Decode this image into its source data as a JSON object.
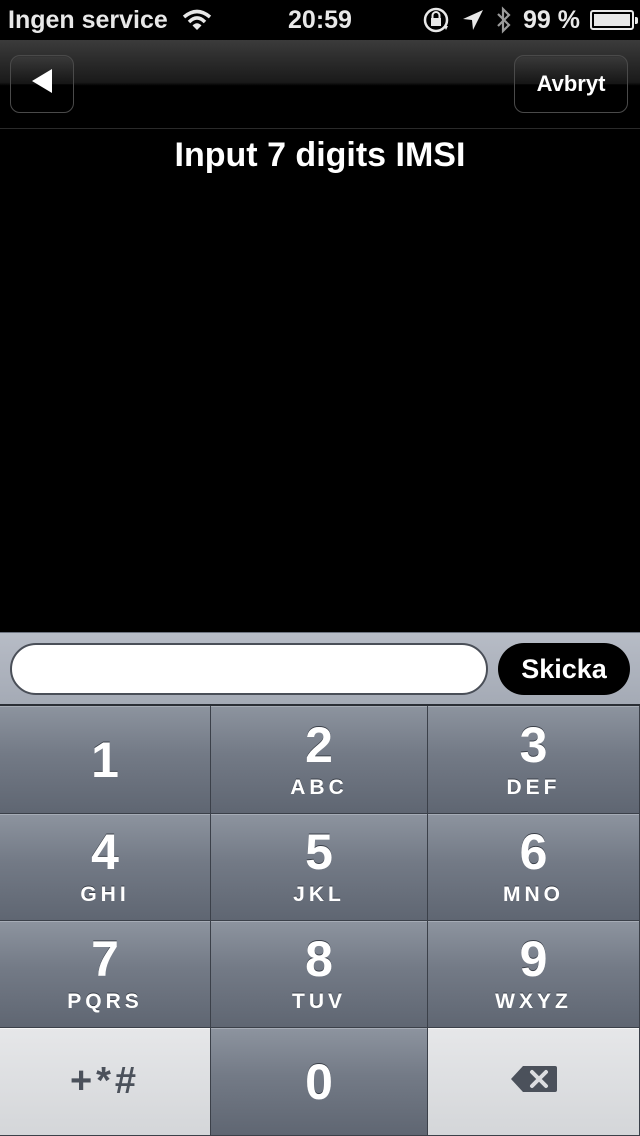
{
  "status_bar": {
    "carrier": "Ingen service",
    "time": "20:59",
    "battery": "99 %",
    "battery_level": 0.99,
    "icons": [
      "wifi-icon",
      "rotation-lock-icon",
      "location-arrow-icon",
      "bluetooth-icon",
      "battery-icon"
    ]
  },
  "navbar": {
    "back_icon": "back-arrow-icon",
    "cancel_label": "Avbryt"
  },
  "prompt": {
    "title": "Input 7 digits IMSI"
  },
  "input_bar": {
    "value": "",
    "placeholder": "",
    "send_label": "Skicka"
  },
  "keypad": {
    "keys": [
      {
        "num": "1",
        "letters": ""
      },
      {
        "num": "2",
        "letters": "ABC"
      },
      {
        "num": "3",
        "letters": "DEF"
      },
      {
        "num": "4",
        "letters": "GHI"
      },
      {
        "num": "5",
        "letters": "JKL"
      },
      {
        "num": "6",
        "letters": "MNO"
      },
      {
        "num": "7",
        "letters": "PQRS"
      },
      {
        "num": "8",
        "letters": "TUV"
      },
      {
        "num": "9",
        "letters": "WXYZ"
      },
      {
        "num": "0",
        "letters": ""
      }
    ],
    "symbols_label": "+*#",
    "delete_icon": "backspace-icon"
  },
  "colors": {
    "keypad_key": "#737a86",
    "keypad_light_key": "#d4d6d9",
    "accessory_bar": "#a4aab5"
  }
}
